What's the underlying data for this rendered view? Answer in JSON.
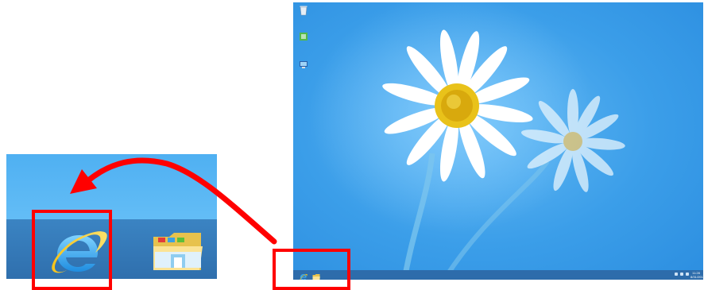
{
  "desktop": {
    "clock": {
      "time": "11:28",
      "date": "8/31/2012"
    },
    "tray_icons": [
      "network-icon",
      "volume-icon",
      "flag-icon"
    ]
  },
  "icons": {
    "internet_explorer": "internet-explorer-icon",
    "file_explorer": "file-explorer-icon",
    "recycle_bin": "recycle-bin-icon",
    "desktop_app_1": "desktop-shortcut-icon",
    "desktop_app_2": "desktop-shortcut-icon"
  },
  "colors": {
    "annotation": "#ff0000",
    "taskbar": "#2d6cab",
    "sky": "#3b9ee9"
  }
}
